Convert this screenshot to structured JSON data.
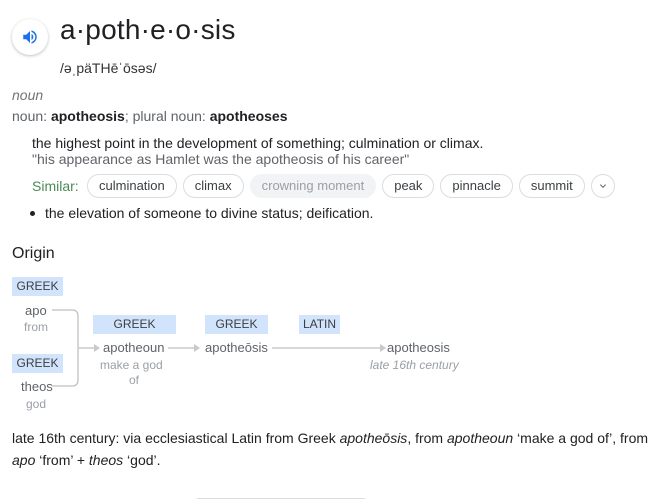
{
  "entry": {
    "headword": "a·poth·e·o·sis",
    "pronunciation": "/əˌpäTHēˈōsəs/",
    "part_of_speech": "noun",
    "forms": {
      "noun_prefix": "noun: ",
      "noun": "apotheosis",
      "plural_prefix": "; plural noun: ",
      "plural": "apotheoses"
    }
  },
  "senses": [
    {
      "definition": "the highest point in the development of something; culmination or climax.",
      "example": "\"his appearance as Hamlet was the apotheosis of his career\"",
      "similar_label": "Similar:",
      "similar": [
        "culmination",
        "climax",
        "crowning moment",
        "peak",
        "pinnacle",
        "summit"
      ]
    },
    {
      "definition": "the elevation of someone to divine status; deification."
    }
  ],
  "origin": {
    "heading": "Origin",
    "langs": {
      "greek1": "GREEK",
      "greek2": "GREEK",
      "greek3": "GREEK",
      "greek4": "GREEK",
      "latin": "LATIN"
    },
    "apo": {
      "word": "apo",
      "gloss": "from"
    },
    "theos": {
      "word": "theos",
      "gloss": "god"
    },
    "apotheoun": {
      "word": "apotheoun",
      "gloss1": "make a god",
      "gloss2": "of"
    },
    "apotheosis_gr": {
      "word": "apotheōsis"
    },
    "apotheosis_lat": {
      "word": "apotheosis",
      "gloss": "late 16th century"
    },
    "text": {
      "t1": "late 16th century: via ecclesiastical Latin from Greek ",
      "w1": "apotheōsis",
      "t2": ", from ",
      "w2": "apotheoun",
      "t3": " ‘make a god of’, from ",
      "w3": "apo",
      "t4": " ‘from’ + ",
      "w4": "theos",
      "t5": " ‘god’."
    }
  },
  "icons": {
    "speaker": "speaker-icon",
    "more": "chevron-down-icon"
  },
  "colors": {
    "similar_label": "#4b8a59",
    "lang_tag": "#d2e3fc"
  }
}
